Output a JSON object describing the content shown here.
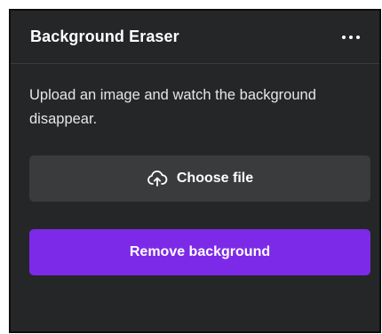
{
  "panel": {
    "title": "Background Eraser",
    "more_icon": "more-horizontal-icon",
    "description": "Upload an image and watch the background disappear.",
    "choose_file": {
      "label": "Choose file",
      "icon": "upload-cloud-icon"
    },
    "remove_background": {
      "label": "Remove background",
      "color": "#7d2ae8"
    }
  },
  "colors": {
    "panel_bg": "#252627",
    "secondary_button_bg": "#3a3b3d",
    "primary_button_bg": "#7d2ae8",
    "text": "#ffffff"
  }
}
